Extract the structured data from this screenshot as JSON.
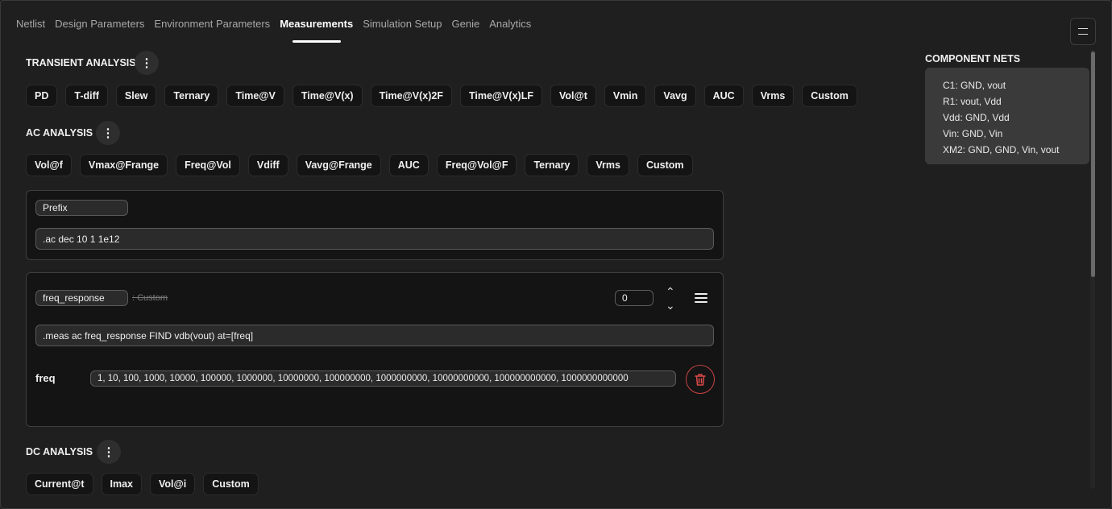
{
  "tabs": [
    "Netlist",
    "Design Parameters",
    "Environment Parameters",
    "Measurements",
    "Simulation Setup",
    "Genie",
    "Analytics"
  ],
  "active_tab": "Measurements",
  "transient": {
    "title": "TRANSIENT ANALYSIS",
    "chips": [
      "PD",
      "T-diff",
      "Slew",
      "Ternary",
      "Time@V",
      "Time@V(x)",
      "Time@V(x)2F",
      "Time@V(x)LF",
      "Vol@t",
      "Vmin",
      "Vavg",
      "AUC",
      "Vrms",
      "Custom"
    ]
  },
  "ac": {
    "title": "AC ANALYSIS",
    "chips": [
      "Vol@f",
      "Vmax@Frange",
      "Freq@Vol",
      "Vdiff",
      "Vavg@Frange",
      "AUC",
      "Freq@Vol@F",
      "Ternary",
      "Vrms",
      "Custom"
    ]
  },
  "prefix_card": {
    "label": "Prefix",
    "value": ".ac dec 10 1 1e12"
  },
  "measure_card": {
    "name": "freq_response",
    "type_label": ": Custom",
    "order": "0",
    "statement": ".meas ac freq_response FIND vdb(vout) at=[freq]",
    "param_label": "freq",
    "param_value": "1, 10, 100, 1000, 10000, 100000, 1000000, 10000000, 100000000, 1000000000, 10000000000, 100000000000, 1000000000000"
  },
  "dc": {
    "title": "DC ANALYSIS",
    "chips": [
      "Current@t",
      "Imax",
      "Vol@i",
      "Custom"
    ]
  },
  "component_nets": {
    "title": "COMPONENT NETS",
    "lines": [
      "C1: GND, vout",
      "R1: vout, Vdd",
      "Vdd: GND, Vdd",
      "Vin: GND, Vin",
      "XM2: GND, GND, Vin, vout"
    ]
  },
  "colors": {
    "background": "#1f1f1f",
    "card": "#141414",
    "danger": "#c94343",
    "nets_panel": "#3a3a3a"
  }
}
